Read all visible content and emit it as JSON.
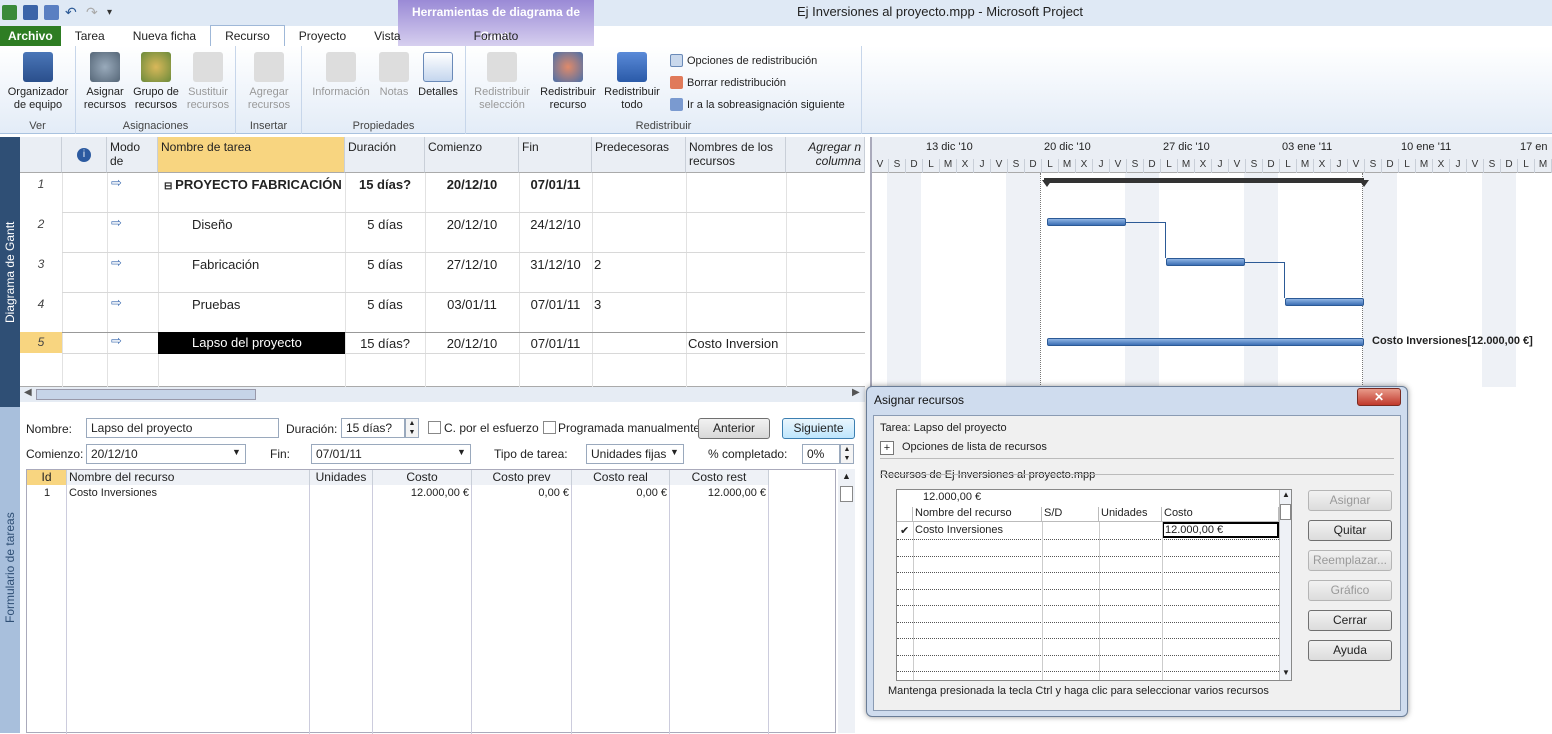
{
  "app": {
    "title": "Ej Inversiones al proyecto.mpp  -  Microsoft Project",
    "contextual_tab_group": "Herramientas de diagrama de Gantt"
  },
  "tabs": [
    "Archivo",
    "Tarea",
    "Nueva ficha",
    "Recurso",
    "Proyecto",
    "Vista"
  ],
  "active_tab": "Recurso",
  "contextual_tab": "Formato",
  "ribbon": {
    "groups": [
      {
        "label": "Ver",
        "buttons": [
          "Organizador de equipo"
        ]
      },
      {
        "label": "Asignaciones",
        "buttons": [
          "Asignar recursos",
          "Grupo de recursos",
          "Sustituir recursos"
        ]
      },
      {
        "label": "Insertar",
        "buttons": [
          "Agregar recursos"
        ]
      },
      {
        "label": "Propiedades",
        "buttons": [
          "Información",
          "Notas",
          "Detalles"
        ]
      },
      {
        "label": "Redistribuir",
        "buttons": [
          "Redistribuir selección",
          "Redistribuir recurso",
          "Redistribuir todo"
        ]
      }
    ],
    "small_buttons": [
      "Opciones de redistribución",
      "Borrar redistribución",
      "Ir a la sobreasignación siguiente"
    ],
    "labels": {
      "org_1": "Organizador",
      "org_2": "de equipo",
      "asig_1": "Asignar",
      "asig_2": "recursos",
      "grupo_1": "Grupo de",
      "grupo_2": "recursos",
      "sust_1": "Sustituir",
      "sust_2": "recursos",
      "agreg_1": "Agregar",
      "agreg_2": "recursos",
      "info": "Información",
      "notas": "Notas",
      "detalles": "Detalles",
      "rsel_1": "Redistribuir",
      "rsel_2": "selección",
      "rrec_1": "Redistribuir",
      "rrec_2": "recurso",
      "rtodo_1": "Redistribuir",
      "rtodo_2": "todo"
    }
  },
  "side_labels": {
    "gantt": "Diagrama de Gantt",
    "form": "Formulario de tareas"
  },
  "grid": {
    "headers": {
      "mode": "Modo de",
      "name": "Nombre de tarea",
      "duration": "Duración",
      "start": "Comienzo",
      "finish": "Fin",
      "pred": "Predecesoras",
      "resources": "Nombres de los recursos",
      "add": "Agregar n columna"
    },
    "rows": [
      {
        "id": "1",
        "name": "PROYECTO FABRICACIÓN",
        "duration": "15 días?",
        "start": "20/12/10",
        "finish": "07/01/11",
        "pred": "",
        "resources": ""
      },
      {
        "id": "2",
        "name": "Diseño",
        "duration": "5 días",
        "start": "20/12/10",
        "finish": "24/12/10",
        "pred": "",
        "resources": ""
      },
      {
        "id": "3",
        "name": "Fabricación",
        "duration": "5 días",
        "start": "27/12/10",
        "finish": "31/12/10",
        "pred": "2",
        "resources": ""
      },
      {
        "id": "4",
        "name": "Pruebas",
        "duration": "5 días",
        "start": "03/01/11",
        "finish": "07/01/11",
        "pred": "3",
        "resources": ""
      },
      {
        "id": "5",
        "name": "Lapso del proyecto",
        "duration": "15 días?",
        "start": "20/12/10",
        "finish": "07/01/11",
        "pred": "",
        "resources": "Costo Inversion"
      }
    ]
  },
  "gantt": {
    "weeks": [
      "13 dic '10",
      "20 dic '10",
      "27 dic '10",
      "03 ene '11",
      "10 ene '11",
      "17 en"
    ],
    "days": [
      "V",
      "S",
      "D",
      "L",
      "M",
      "X",
      "J",
      "V",
      "S",
      "D",
      "L",
      "M",
      "X",
      "J",
      "V",
      "S",
      "D",
      "L",
      "M",
      "X",
      "J",
      "V",
      "S",
      "D",
      "L",
      "M",
      "X",
      "J",
      "V",
      "S",
      "D",
      "L",
      "M",
      "X",
      "J",
      "V",
      "S",
      "D",
      "L",
      "M"
    ],
    "bar_label": "Costo Inversiones[12.000,00 €]"
  },
  "form": {
    "labels": {
      "name": "Nombre:",
      "duration": "Duración:",
      "effort": "C. por el esfuerzo",
      "manual": "Programada manualmente",
      "start": "Comienzo:",
      "finish": "Fin:",
      "type": "Tipo de tarea:",
      "complete": "% completado:"
    },
    "values": {
      "name": "Lapso del proyecto",
      "duration": "15 días?",
      "start": "20/12/10",
      "finish": "07/01/11",
      "type": "Unidades fijas",
      "complete": "0%"
    },
    "buttons": {
      "prev": "Anterior",
      "next": "Siguiente"
    },
    "table": {
      "headers": [
        "Id",
        "Nombre del recurso",
        "Unidades",
        "Costo",
        "Costo prev",
        "Costo real",
        "Costo rest"
      ],
      "rows": [
        {
          "id": "1",
          "name": "Costo Inversiones",
          "units": "",
          "cost": "12.000,00 €",
          "prev": "0,00 €",
          "real": "0,00 €",
          "rest": "12.000,00 €"
        }
      ]
    }
  },
  "dialog": {
    "title": "Asignar recursos",
    "task": "Tarea: Lapso del proyecto",
    "options": "Opciones de lista de recursos",
    "resources_label": "Recursos de Ej Inversiones al proyecto.mpp",
    "edit_value": "12.000,00 €",
    "headers": [
      "Nombre del recurso",
      "S/D",
      "Unidades",
      "Costo"
    ],
    "row": {
      "check": "✔",
      "name": "Costo Inversiones",
      "cost": "12.000,00 €"
    },
    "buttons": [
      "Asignar",
      "Quitar",
      "Reemplazar...",
      "Gráfico",
      "Cerrar",
      "Ayuda"
    ],
    "hint": "Mantenga presionada la tecla Ctrl y haga clic para seleccionar varios recursos"
  },
  "colors": {
    "file_tab": "#2e7d23",
    "gantt_bar": "#3c6fb5",
    "selected_header": "#f8d580",
    "side_panel": "#2f4f75"
  }
}
